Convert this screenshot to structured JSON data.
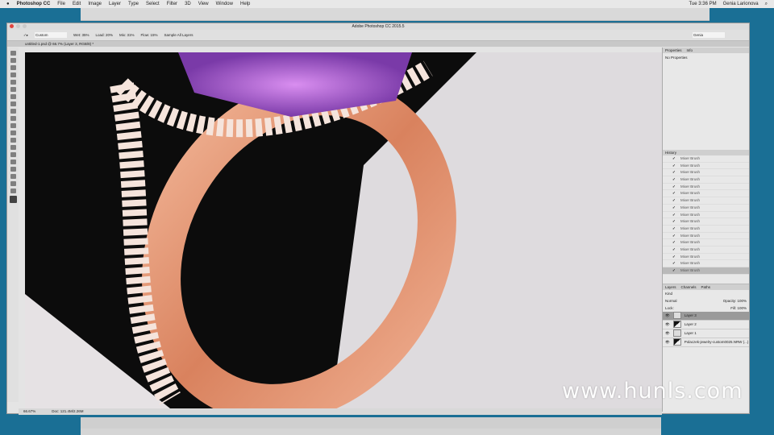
{
  "menubar": {
    "app": "Photoshop CC",
    "items": [
      "File",
      "Edit",
      "Image",
      "Layer",
      "Type",
      "Select",
      "Filter",
      "3D",
      "View",
      "Window",
      "Help"
    ],
    "clock": "Tue 3:36 PM",
    "user": "Genia Larionova"
  },
  "window": {
    "title": "Adobe Photoshop CC 2015.5",
    "workspace": "Genia"
  },
  "options": {
    "preset": "Custom",
    "wet": "Wet: 35%",
    "load": "Load: 20%",
    "mix": "Mix: 31%",
    "flow": "Flow: 15%",
    "sample": "Sample All Layers"
  },
  "document": {
    "tab": "untitled-1.psd @ 66.7% (Layer 3, RGB/8) *",
    "zoom": "66.67%",
    "doc": "Doc: 121.4M/2.26M"
  },
  "properties": {
    "tabs": [
      "Properties",
      "Info"
    ],
    "text": "No Properties"
  },
  "history": {
    "title": "History",
    "items": [
      "Mixer Brush",
      "Mixer Brush",
      "Mixer Brush",
      "Mixer Brush",
      "Mixer Brush",
      "Mixer Brush",
      "Mixer Brush",
      "Mixer Brush",
      "Mixer Brush",
      "Mixer Brush",
      "Mixer Brush",
      "Mixer Brush",
      "Mixer Brush",
      "Mixer Brush",
      "Mixer Brush",
      "Mixer Brush",
      "Mixer Brush"
    ]
  },
  "layers": {
    "tabs": [
      "Layers",
      "Channels",
      "Paths"
    ],
    "kind": "Kind",
    "blend": "Normal",
    "opacity": "Opacity: 100%",
    "lock": "Lock:",
    "fill": "Fill: 100%",
    "items": [
      {
        "name": "Layer 3",
        "thumb": "light"
      },
      {
        "name": "Layer 2",
        "thumb": "dark"
      },
      {
        "name": "Layer 1",
        "thumb": "light"
      },
      {
        "name": "Polaczek-jewelry-custom0025.NRW (...)",
        "thumb": "dark"
      }
    ]
  },
  "watermark": "www.hunls.com"
}
